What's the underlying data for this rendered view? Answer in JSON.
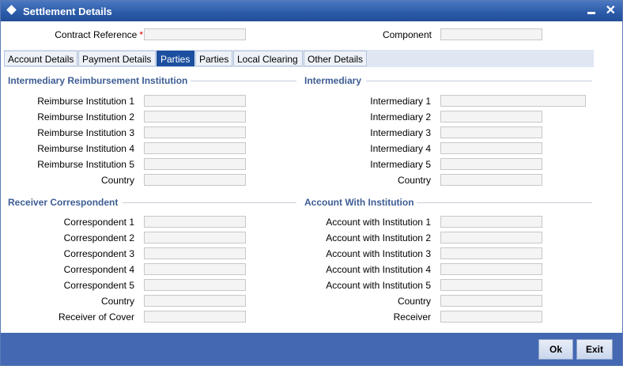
{
  "window": {
    "title": "Settlement Details"
  },
  "header": {
    "contract_reference_label": "Contract Reference",
    "required_mark": "*",
    "contract_reference_value": "",
    "component_label": "Component",
    "component_value": ""
  },
  "tabs": [
    {
      "label": "Account Details"
    },
    {
      "label": "Payment Details"
    },
    {
      "label": "Parties",
      "active": true
    },
    {
      "label": "Parties"
    },
    {
      "label": "Local Clearing"
    },
    {
      "label": "Other Details"
    }
  ],
  "sections": {
    "intermediary_reimbursement": {
      "title": "Intermediary Reimbursement Institution",
      "fields": [
        "Reimburse Institution 1",
        "Reimburse Institution 2",
        "Reimburse Institution 3",
        "Reimburse Institution 4",
        "Reimburse Institution 5",
        "Country"
      ]
    },
    "intermediary": {
      "title": "Intermediary",
      "fields": [
        "Intermediary 1",
        "Intermediary 2",
        "Intermediary 3",
        "Intermediary 4",
        "Intermediary 5",
        "Country"
      ]
    },
    "receiver_correspondent": {
      "title": "Receiver Correspondent",
      "fields": [
        "Correspondent 1",
        "Correspondent 2",
        "Correspondent 3",
        "Correspondent 4",
        "Correspondent 5",
        "Country",
        "Receiver of Cover"
      ]
    },
    "account_with_institution": {
      "title": "Account With Institution",
      "fields": [
        "Account with Institution 1",
        "Account with Institution 2",
        "Account with Institution 3",
        "Account with Institution 4",
        "Account with Institution 5",
        "Country",
        "Receiver"
      ]
    }
  },
  "buttons": {
    "ok": "Ok",
    "exit": "Exit"
  }
}
